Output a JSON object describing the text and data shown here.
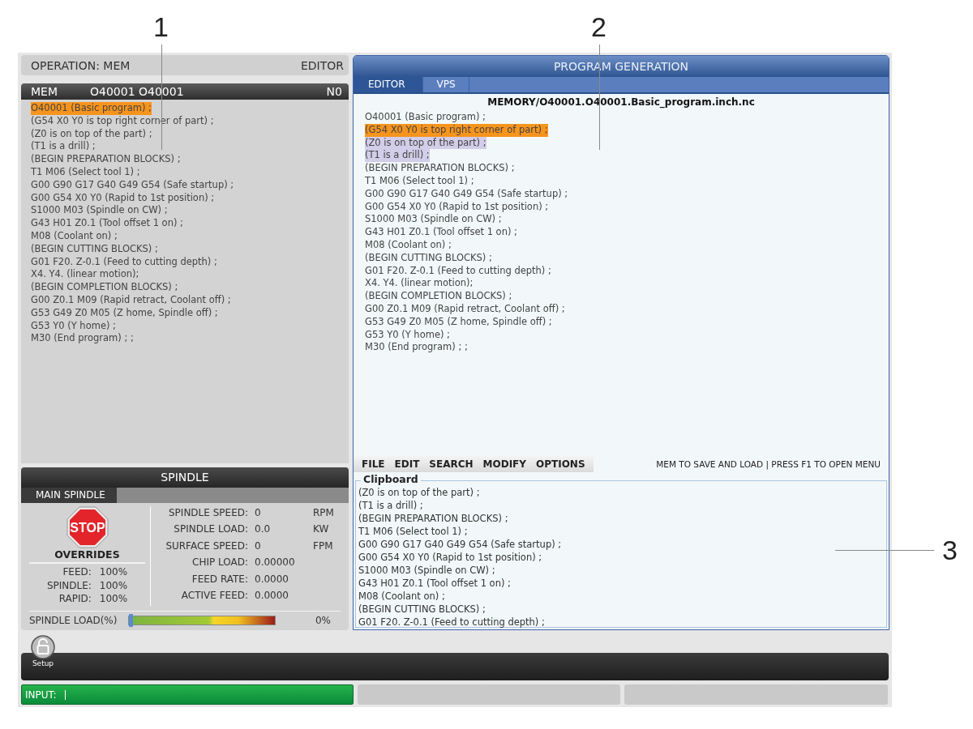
{
  "callouts": [
    {
      "label": "1"
    },
    {
      "label": "2"
    },
    {
      "label": "3"
    }
  ],
  "operation_bar": {
    "mode": "OPERATION: MEM",
    "screen": "EDITOR"
  },
  "active_program": {
    "header": {
      "mode": "MEM",
      "program": "O40001 O40001",
      "block": "N0"
    },
    "lines": [
      {
        "text": "O40001 (Basic program) ;",
        "current": true,
        "selected": false
      },
      {
        "text": "(G54 X0 Y0 is top right corner of part) ;",
        "current": false,
        "selected": false
      },
      {
        "text": "(Z0 is on top of the part) ;",
        "current": false,
        "selected": false
      },
      {
        "text": "(T1 is a drill) ;",
        "current": false,
        "selected": false
      },
      {
        "text": "(BEGIN PREPARATION BLOCKS) ;",
        "current": false,
        "selected": false
      },
      {
        "text": "T1 M06 (Select tool 1) ;",
        "current": false,
        "selected": false
      },
      {
        "text": "G00 G90 G17 G40 G49 G54 (Safe startup) ;",
        "current": false,
        "selected": false
      },
      {
        "text": "G00 G54 X0 Y0 (Rapid to 1st position) ;",
        "current": false,
        "selected": false
      },
      {
        "text": "S1000 M03 (Spindle on CW) ;",
        "current": false,
        "selected": false
      },
      {
        "text": "G43 H01 Z0.1 (Tool offset 1 on) ;",
        "current": false,
        "selected": false
      },
      {
        "text": "M08 (Coolant on) ;",
        "current": false,
        "selected": false
      },
      {
        "text": "(BEGIN CUTTING BLOCKS) ;",
        "current": false,
        "selected": false
      },
      {
        "text": "G01 F20. Z-0.1 (Feed to cutting depth) ;",
        "current": false,
        "selected": false
      },
      {
        "text": "X4. Y4. (linear motion);",
        "current": false,
        "selected": false
      },
      {
        "text": "(BEGIN COMPLETION BLOCKS) ;",
        "current": false,
        "selected": false
      },
      {
        "text": "G00 Z0.1 M09 (Rapid retract, Coolant off) ;",
        "current": false,
        "selected": false
      },
      {
        "text": "G53 G49 Z0 M05 (Z home, Spindle off) ;",
        "current": false,
        "selected": false
      },
      {
        "text": "G53 Y0 (Y home) ;",
        "current": false,
        "selected": false
      },
      {
        "text": "M30 (End program) ; ;",
        "current": false,
        "selected": false
      }
    ]
  },
  "spindle": {
    "title": "SPINDLE",
    "tab": "MAIN SPINDLE",
    "stop_sign": "STOP",
    "overrides_title": "OVERRIDES",
    "overrides": [
      {
        "label": "FEED:",
        "value": "100%"
      },
      {
        "label": "SPINDLE:",
        "value": "100%"
      },
      {
        "label": "RAPID:",
        "value": "100%"
      }
    ],
    "readings": [
      {
        "label": "SPINDLE SPEED:",
        "value": "0",
        "unit": "RPM"
      },
      {
        "label": "SPINDLE LOAD:",
        "value": "0.0",
        "unit": "KW"
      },
      {
        "label": "SURFACE SPEED:",
        "value": "0",
        "unit": "FPM"
      },
      {
        "label": "CHIP LOAD:",
        "value": "0.00000"
      },
      {
        "label": "FEED RATE:",
        "value": "0.0000"
      },
      {
        "label": "ACTIVE FEED:",
        "value": "0.0000"
      }
    ],
    "load": {
      "label": "SPINDLE LOAD(%)",
      "level": 0,
      "reading": "0%"
    }
  },
  "program_generation": {
    "title": "PROGRAM GENERATION",
    "tabs": [
      {
        "label": "EDITOR",
        "selected": true
      },
      {
        "label": "VPS",
        "selected": false
      }
    ],
    "file_path": "MEMORY/O40001.O40001.Basic_program.inch.nc",
    "lines": [
      {
        "text": "O40001 (Basic program) ;",
        "current": false,
        "selected": false
      },
      {
        "text": "(G54 X0 Y0 is top right corner of part) ;",
        "current": true,
        "selected": false
      },
      {
        "text": "(Z0 is on top of the part) ;",
        "current": false,
        "selected": true
      },
      {
        "text": "(T1 is a drill) ;",
        "current": false,
        "selected": true
      },
      {
        "text": "(BEGIN PREPARATION BLOCKS) ;",
        "current": false,
        "selected": false
      },
      {
        "text": "T1 M06 (Select tool 1) ;",
        "current": false,
        "selected": false
      },
      {
        "text": "G00 G90 G17 G40 G49 G54 (Safe startup) ;",
        "current": false,
        "selected": false
      },
      {
        "text": "G00 G54 X0 Y0 (Rapid to 1st position) ;",
        "current": false,
        "selected": false
      },
      {
        "text": "S1000 M03 (Spindle on CW) ;",
        "current": false,
        "selected": false
      },
      {
        "text": "G43 H01 Z0.1 (Tool offset 1 on) ;",
        "current": false,
        "selected": false
      },
      {
        "text": "M08 (Coolant on) ;",
        "current": false,
        "selected": false
      },
      {
        "text": "(BEGIN CUTTING BLOCKS) ;",
        "current": false,
        "selected": false
      },
      {
        "text": "G01 F20. Z-0.1 (Feed to cutting depth) ;",
        "current": false,
        "selected": false
      },
      {
        "text": "X4. Y4. (linear motion);",
        "current": false,
        "selected": false
      },
      {
        "text": "(BEGIN COMPLETION BLOCKS) ;",
        "current": false,
        "selected": false
      },
      {
        "text": "G00 Z0.1 M09 (Rapid retract, Coolant off) ;",
        "current": false,
        "selected": false
      },
      {
        "text": "G53 G49 Z0 M05 (Z home, Spindle off) ;",
        "current": false,
        "selected": false
      },
      {
        "text": "G53 Y0 (Y home) ;",
        "current": false,
        "selected": false
      },
      {
        "text": "M30 (End program) ; ;",
        "current": false,
        "selected": false
      }
    ],
    "menu": [
      "FILE",
      "EDIT",
      "SEARCH",
      "MODIFY",
      "OPTIONS"
    ],
    "hint": "MEM TO SAVE AND LOAD | PRESS F1 TO OPEN MENU",
    "clipboard": {
      "title": "Clipboard",
      "lines": [
        "(Z0 is on top of the part) ;",
        "(T1 is a drill) ;",
        "(BEGIN PREPARATION BLOCKS) ;",
        "T1 M06 (Select tool 1) ;",
        "G00 G90 G17 G40 G49 G54 (Safe startup) ;",
        "G00 G54 X0 Y0 (Rapid to 1st position) ;",
        "S1000 M03 (Spindle on CW) ;",
        "G43 H01 Z0.1 (Tool offset 1 on) ;",
        "M08 (Coolant on) ;",
        "(BEGIN CUTTING BLOCKS) ;",
        "G01 F20. Z-0.1 (Feed to cutting depth) ;"
      ]
    }
  },
  "toolbar": {
    "setup": "Setup"
  },
  "input_bar": {
    "label": "INPUT:"
  }
}
